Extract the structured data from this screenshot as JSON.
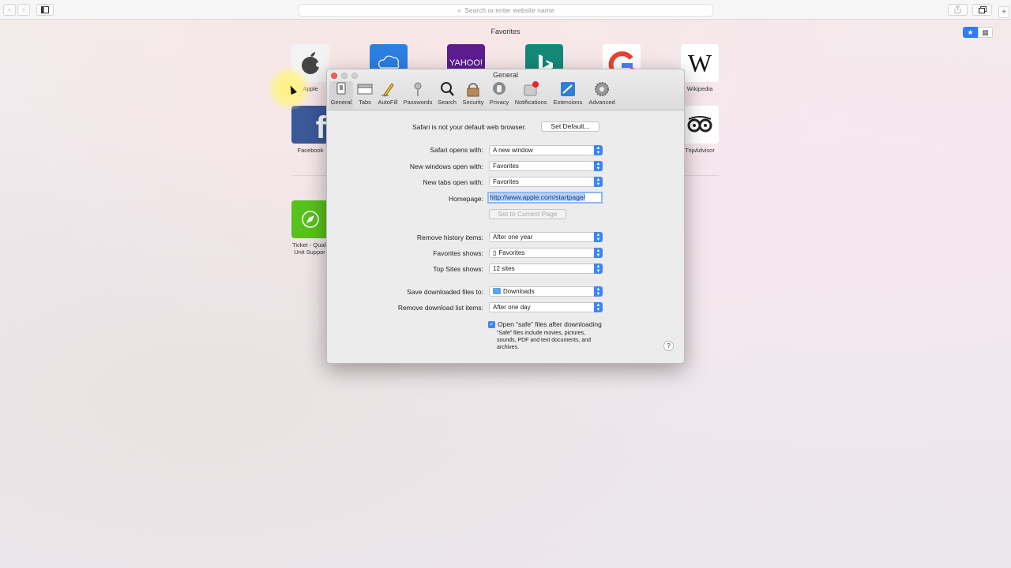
{
  "toolbar": {
    "back_icon": "‹",
    "forward_icon": "›",
    "sidebar_icon": "sidebar-icon",
    "search_placeholder": "Search or enter website name",
    "share_icon": "share-icon",
    "tabs_icon": "tabs-icon",
    "new_tab_icon": "+"
  },
  "favorites": {
    "title": "Favorites",
    "view_toggle_star": "★",
    "view_toggle_grid": "▦",
    "tiles": [
      {
        "label": "Apple"
      },
      {
        "label": "Facebook"
      },
      {
        "label": "Wikipedia"
      },
      {
        "label": "TripAdvisor"
      },
      {
        "label": "Ticket - Quali",
        "label2": "Unit Suppor"
      },
      {
        "label": "YAHOO!"
      }
    ]
  },
  "window": {
    "title": "General",
    "tabs": [
      {
        "label": "General"
      },
      {
        "label": "Tabs"
      },
      {
        "label": "AutoFill"
      },
      {
        "label": "Passwords"
      },
      {
        "label": "Search"
      },
      {
        "label": "Security"
      },
      {
        "label": "Privacy"
      },
      {
        "label": "Notifications"
      },
      {
        "label": "Extensions"
      },
      {
        "label": "Advanced"
      }
    ],
    "default_browser_text": "Safari is not your default web browser.",
    "set_default_button": "Set Default...",
    "opens_with_label": "Safari opens with:",
    "opens_with_value": "A new window",
    "new_windows_label": "New windows open with:",
    "new_windows_value": "Favorites",
    "new_tabs_label": "New tabs open with:",
    "new_tabs_value": "Favorites",
    "homepage_label": "Homepage:",
    "homepage_value": "http://www.apple.com/startpage/",
    "set_current_button": "Set to Current Page",
    "remove_history_label": "Remove history items:",
    "remove_history_value": "After one year",
    "favorites_shows_label": "Favorites shows:",
    "favorites_shows_value": "Favorites",
    "top_sites_label": "Top Sites shows:",
    "top_sites_value": "12 sites",
    "save_downloads_label": "Save downloaded files to:",
    "save_downloads_value": "Downloads",
    "remove_download_label": "Remove download list items:",
    "remove_download_value": "After one day",
    "open_safe_label": "Open “safe” files after downloading",
    "safe_note_1": "“Safe” files include movies, pictures,",
    "safe_note_2": "sounds, PDF and text documents, and",
    "safe_note_3": "archives.",
    "help": "?"
  }
}
